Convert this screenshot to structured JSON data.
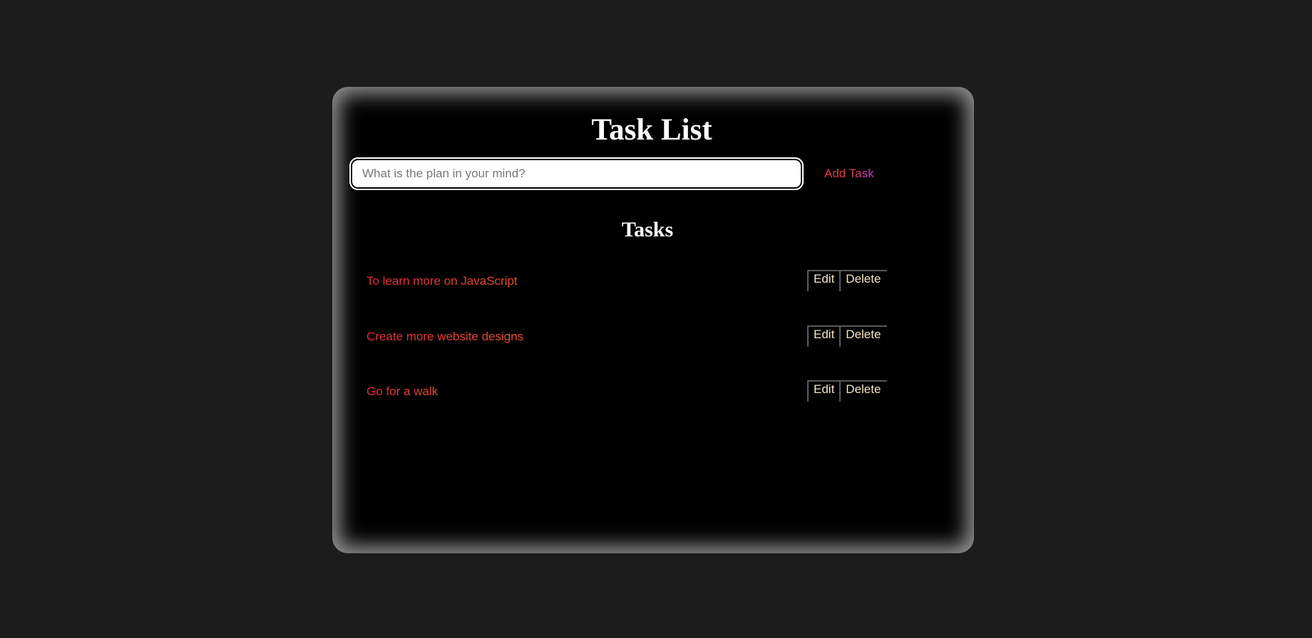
{
  "app": {
    "title": "Task List",
    "input_placeholder": "What is the plan in your mind?",
    "input_value": "",
    "add_button_label": "Add Task",
    "tasks_heading": "Tasks"
  },
  "tasks": [
    {
      "text": "To learn more on JavaScript",
      "edit_label": "Edit",
      "delete_label": "Delete"
    },
    {
      "text": "Create more website designs",
      "edit_label": "Edit",
      "delete_label": "Delete"
    },
    {
      "text": "Go for a walk",
      "edit_label": "Edit",
      "delete_label": "Delete"
    }
  ],
  "colors": {
    "page_background": "#1c1c1c",
    "card_background": "#000000",
    "task_text": "#e8373c",
    "button_text": "#f3e6c8"
  }
}
